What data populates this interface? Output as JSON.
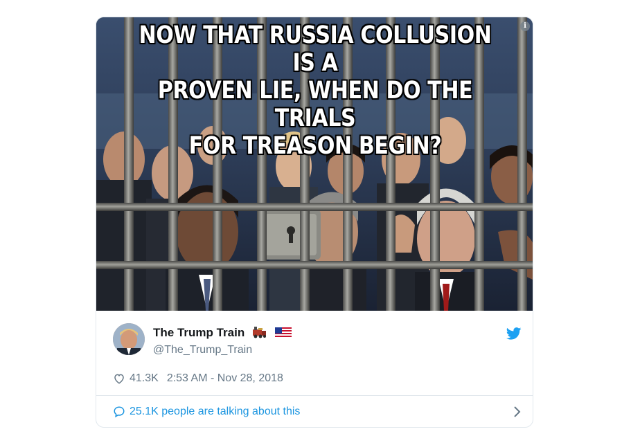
{
  "tweet": {
    "meme_text": "NOW THAT RUSSIA COLLUSION IS A\nPROVEN LIE, WHEN DO THE TRIALS\nFOR TREASON BEGIN?",
    "image_description_icon": "info-icon",
    "author_name": "The Trump Train",
    "author_emojis": [
      "train-emoji",
      "us-flag-emoji"
    ],
    "author_handle": "@The_Trump_Train",
    "likes": "41.3K",
    "timestamp": "2:53 AM - Nov 28, 2018",
    "talking_text": "25.1K people are talking about this",
    "icons": {
      "brand": "twitter-bird-icon",
      "like": "heart-icon",
      "conversation": "speech-bubble-icon",
      "more": "chevron-right-icon"
    }
  },
  "colors": {
    "brand_blue": "#1da1f2",
    "link_blue": "#1b95e0",
    "secondary_text": "#657786",
    "primary_text": "#14171a",
    "border": "#e1e8ed"
  }
}
